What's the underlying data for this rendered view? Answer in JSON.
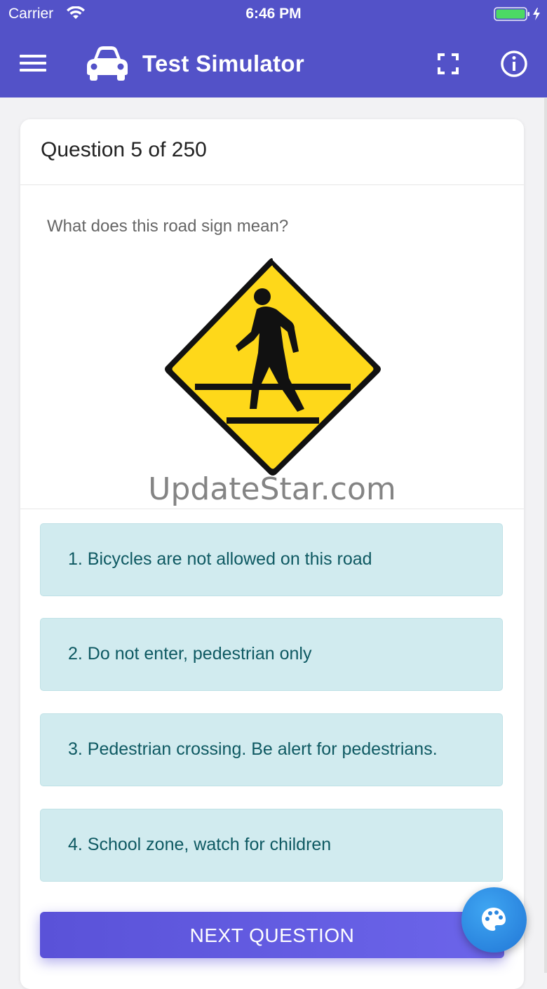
{
  "status_bar": {
    "carrier": "Carrier",
    "time": "6:46 PM",
    "wifi_icon": "wifi-icon",
    "battery_icon": "battery-charging-icon",
    "battery_level": 1.0,
    "battery_color": "#4cd964"
  },
  "app_bar": {
    "title": "Test Simulator",
    "menu_icon": "menu-icon",
    "logo_icon": "car-icon",
    "fullscreen_icon": "fullscreen-icon",
    "info_icon": "info-icon",
    "color": "#5352c8"
  },
  "question": {
    "counter": "Question 5 of 250",
    "text": "What does this road sign mean?",
    "image_icon": "pedestrian-crossing-sign",
    "watermark": "UpdateStar.com"
  },
  "answers": [
    {
      "label": "1. Bicycles are not allowed on this road"
    },
    {
      "label": "2. Do not enter, pedestrian only"
    },
    {
      "label": "3. Pedestrian crossing. Be alert for pedestrians."
    },
    {
      "label": "4. School zone, watch for children"
    }
  ],
  "next_button": {
    "label": "NEXT QUESTION",
    "color": "#5a52d8"
  },
  "fab": {
    "icon": "palette-icon",
    "color": "#2e8ee6"
  },
  "answer_style": {
    "background": "#d1ebef",
    "text_color": "#0e5962"
  }
}
